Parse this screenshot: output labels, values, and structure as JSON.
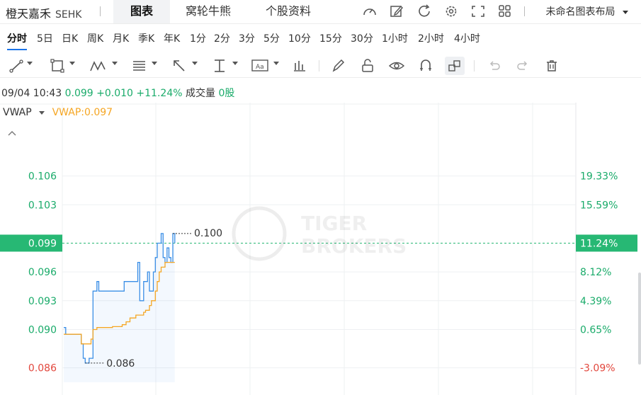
{
  "header": {
    "stock_name": "橙天嘉禾",
    "market": "SEHK",
    "tabs": [
      "图表",
      "窝轮牛熊",
      "个股资料"
    ],
    "layout_label": "未命名图表布局"
  },
  "periods": [
    "分时",
    "5日",
    "日K",
    "周K",
    "月K",
    "季K",
    "年K",
    "1分",
    "2分",
    "3分",
    "5分",
    "10分",
    "15分",
    "30分",
    "1小时",
    "2小时",
    "4小时"
  ],
  "active_period": "分时",
  "info": {
    "datetime": "09/04 10:43",
    "price": "0.099",
    "change": "+0.010",
    "change_pct": "+11.24%",
    "volume_label": "成交量",
    "volume": "0股"
  },
  "indicator": {
    "name": "VWAP",
    "value_label": "VWAP:0.097"
  },
  "chart_data": {
    "type": "line",
    "y_left_ticks": [
      "0.106",
      "0.103",
      "0.099",
      "0.096",
      "0.093",
      "0.090",
      "0.086"
    ],
    "y_right_ticks": [
      "19.33%",
      "15.59%",
      "11.24%",
      "8.12%",
      "4.39%",
      "0.65%",
      "-3.09%"
    ],
    "current_price_label": "0.099",
    "current_pct_label": "11.24%",
    "high_annotation": "0.100",
    "low_annotation": "0.086",
    "ylim": [
      0.0845,
      0.1087
    ],
    "series": [
      {
        "name": "Price",
        "color": "#3a8ee6",
        "values": [
          0.0902,
          0.0895,
          0.0895,
          0.0895,
          0.0895,
          0.0895,
          0.0895,
          0.0895,
          0.0895,
          0.0885,
          0.087,
          0.0865,
          0.0865,
          0.087,
          0.087,
          0.094,
          0.094,
          0.095,
          0.094,
          0.094,
          0.094,
          0.094,
          0.094,
          0.094,
          0.094,
          0.094,
          0.094,
          0.094,
          0.094,
          0.094,
          0.094,
          0.095,
          0.095,
          0.095,
          0.095,
          0.095,
          0.095,
          0.095,
          0.097,
          0.093,
          0.093,
          0.095,
          0.095,
          0.096,
          0.094,
          0.094,
          0.096,
          0.0975,
          0.099,
          0.099,
          0.1,
          0.0975,
          0.097,
          0.0985,
          0.0975,
          0.097,
          0.1,
          0.099
        ]
      },
      {
        "name": "VWAP",
        "color": "#f5a623",
        "values": [
          0.0895,
          0.0895,
          0.0895,
          0.0895,
          0.0895,
          0.0895,
          0.0895,
          0.0895,
          0.0895,
          0.0885,
          0.0885,
          0.0885,
          0.0885,
          0.0885,
          0.089,
          0.09,
          0.09,
          0.0902,
          0.0902,
          0.0902,
          0.0902,
          0.0902,
          0.0902,
          0.0902,
          0.0902,
          0.0903,
          0.0903,
          0.0903,
          0.0903,
          0.0903,
          0.0905,
          0.0905,
          0.0908,
          0.0908,
          0.0912,
          0.0912,
          0.0912,
          0.0915,
          0.0915,
          0.0915,
          0.0915,
          0.0918,
          0.092,
          0.092,
          0.0925,
          0.093,
          0.093,
          0.094,
          0.095,
          0.096,
          0.0965,
          0.0965,
          0.097,
          0.097,
          0.097,
          0.097,
          0.097,
          0.097
        ]
      }
    ]
  }
}
